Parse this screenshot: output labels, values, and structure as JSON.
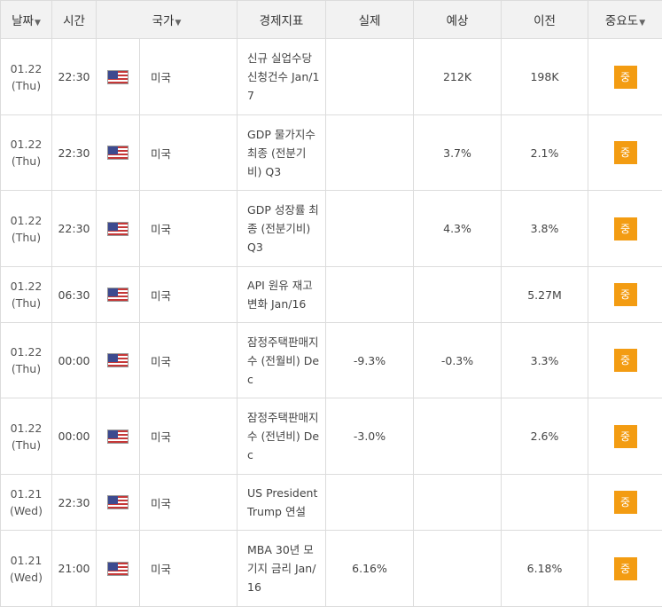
{
  "header": {
    "date": "날짜",
    "time": "시간",
    "country": "국가",
    "indicator": "경제지표",
    "actual": "실제",
    "forecast": "예상",
    "previous": "이전",
    "importance": "중요도",
    "sort_arrow": "▼"
  },
  "rows": [
    {
      "date": "01.22",
      "day": "(Thu)",
      "time": "22:30",
      "country": "미국",
      "indicator": "신규 실업수당 신청건수 Jan/17",
      "actual": "",
      "forecast": "212K",
      "previous": "198K",
      "importance": "중"
    },
    {
      "date": "01.22",
      "day": "(Thu)",
      "time": "22:30",
      "country": "미국",
      "indicator": "GDP 물가지수 최종 (전분기비) Q3",
      "actual": "",
      "forecast": "3.7%",
      "previous": "2.1%",
      "importance": "중"
    },
    {
      "date": "01.22",
      "day": "(Thu)",
      "time": "22:30",
      "country": "미국",
      "indicator": "GDP 성장률 최종 (전분기비) Q3",
      "actual": "",
      "forecast": "4.3%",
      "previous": "3.8%",
      "importance": "중"
    },
    {
      "date": "01.22",
      "day": "(Thu)",
      "time": "06:30",
      "country": "미국",
      "indicator": "API 원유 재고 변화 Jan/16",
      "actual": "",
      "forecast": "",
      "previous": "5.27M",
      "importance": "중"
    },
    {
      "date": "01.22",
      "day": "(Thu)",
      "time": "00:00",
      "country": "미국",
      "indicator": "잠정주택판매지수 (전월비) Dec",
      "actual": "-9.3%",
      "forecast": "-0.3%",
      "previous": "3.3%",
      "importance": "중"
    },
    {
      "date": "01.22",
      "day": "(Thu)",
      "time": "00:00",
      "country": "미국",
      "indicator": "잠정주택판매지수 (전년비) Dec",
      "actual": "-3.0%",
      "forecast": "",
      "previous": "2.6%",
      "importance": "중"
    },
    {
      "date": "01.21",
      "day": "(Wed)",
      "time": "22:30",
      "country": "미국",
      "indicator": "US President Trump 연설",
      "actual": "",
      "forecast": "",
      "previous": "",
      "importance": "중"
    },
    {
      "date": "01.21",
      "day": "(Wed)",
      "time": "21:00",
      "country": "미국",
      "indicator": "MBA 30년 모기지 금리 Jan/16",
      "actual": "6.16%",
      "forecast": "",
      "previous": "6.18%",
      "importance": "중"
    }
  ]
}
